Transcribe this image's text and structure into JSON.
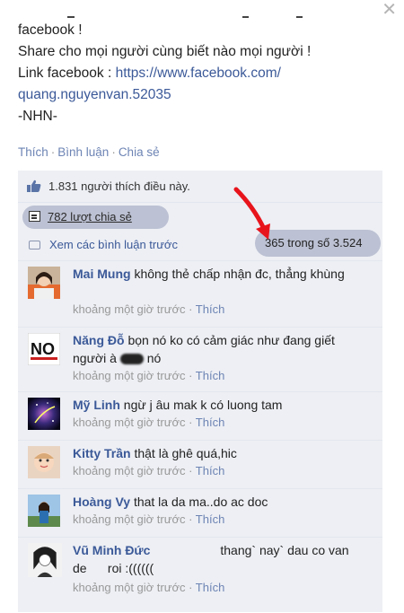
{
  "post": {
    "line1": "facebook !",
    "line2": "Share cho mọi người cùng biết nào mọi người !",
    "line3_prefix": "Link facebook : ",
    "link_part1": "https://www.facebook.com/",
    "link_part2": "quang.nguyenvan.52035",
    "signature": "-NHN-"
  },
  "actions": {
    "like": "Thích",
    "comment": "Bình luận",
    "share": "Chia sẻ"
  },
  "likes_text": "1.831 người thích điều này.",
  "shares_text": "782 lượt chia sẻ",
  "view_previous": "Xem các bình luận trước",
  "comment_count": "365 trong số 3.524",
  "comments": [
    {
      "author": "Mai Mung",
      "text": "không thẻ chấp nhận đc, thẳng khùng",
      "time": "khoảng một giờ trước",
      "like": "Thích",
      "avatar": "girl-portrait"
    },
    {
      "author": "Năng Đỗ",
      "text": "bọn nó ko có cảm giác như đang giết người à",
      "text2": "nó",
      "time": "khoảng một giờ trước",
      "like": "Thích",
      "avatar": "no-sign"
    },
    {
      "author": "Mỹ Linh",
      "text": "ngừ j âu mak k có luong tam",
      "time": "khoảng một giờ trước",
      "like": "Thích",
      "avatar": "galaxy"
    },
    {
      "author": "Kitty Trần",
      "text": "thật là ghê quá,hic",
      "time": "khoảng một giờ trước",
      "like": "Thích",
      "avatar": "baby"
    },
    {
      "author": "Hoàng Vy",
      "text": "that la da ma..do ac doc",
      "time": "khoảng một giờ trước",
      "like": "Thích",
      "avatar": "girl-outdoor"
    },
    {
      "author": "Vũ Minh Đức",
      "text": "thang` nay` dau co van",
      "text2": "de      roi :((((((",
      "time": "khoảng một giờ trước",
      "like": "Thích",
      "avatar": "sketch-portrait"
    }
  ],
  "colors": {
    "link": "#3b5998",
    "panel": "#edeff4",
    "highlight": "#bcc1d3",
    "arrow": "#e8141c"
  }
}
